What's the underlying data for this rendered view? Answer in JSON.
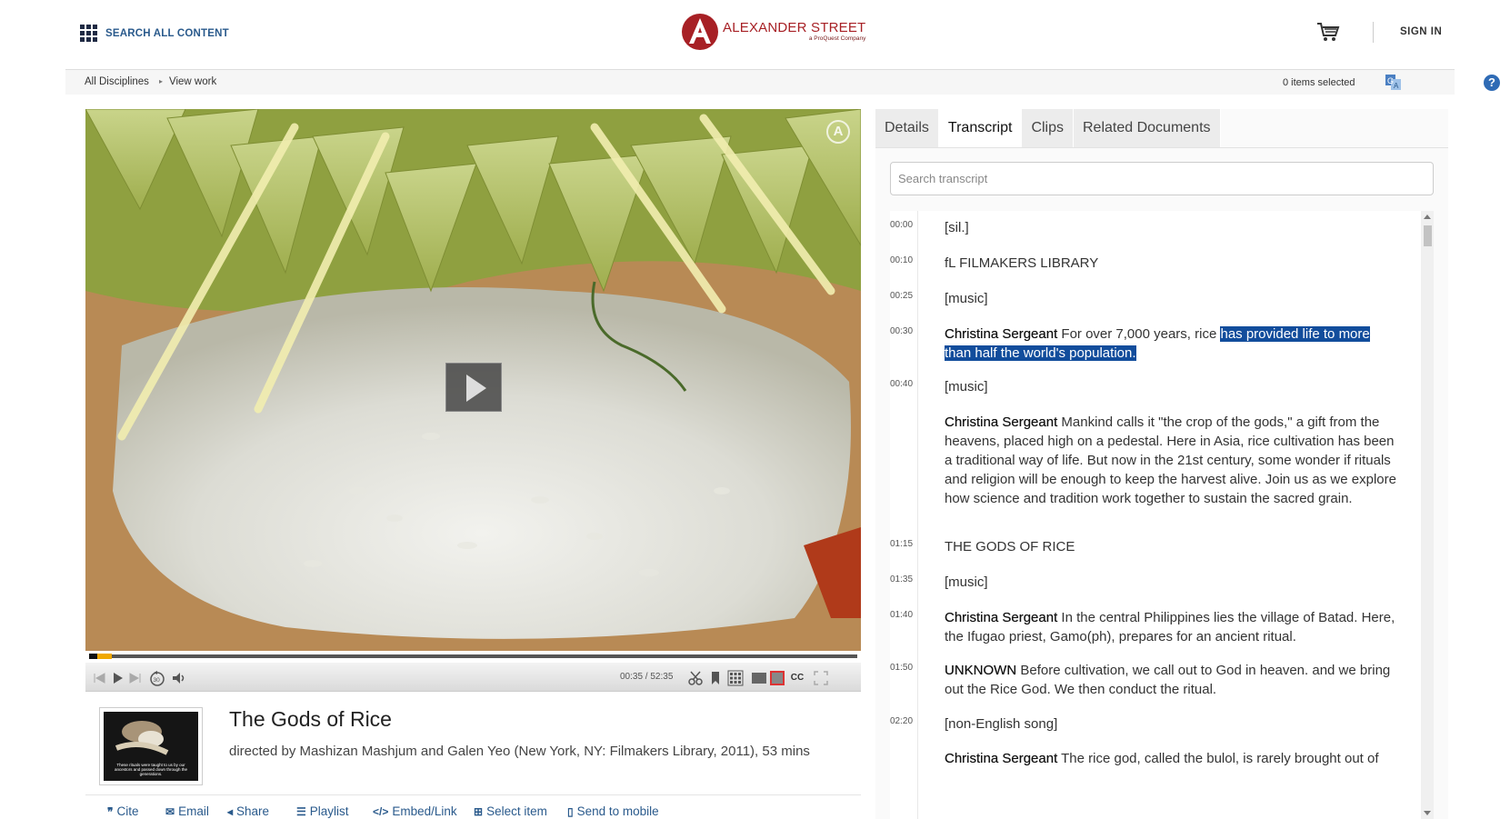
{
  "header": {
    "search_all_label": "SEARCH ALL CONTENT",
    "logo_name": "ALEXANDER STREET",
    "logo_sub": "a ProQuest Company",
    "sign_in_label": "SIGN IN"
  },
  "breadcrumb": {
    "items": [
      "All Disciplines",
      "View work"
    ],
    "separator": "▸",
    "selected_count": "0 items selected",
    "help_label": "?"
  },
  "player": {
    "time_current": "00:35",
    "time_total": "52:35",
    "time_separator": " / ",
    "progress_fraction": 0.011,
    "watermark_letter": "A",
    "cc_label": "CC"
  },
  "work": {
    "title": "The Gods of Rice",
    "credits": "directed by Mashizan Mashjum and Galen Yeo (New York, NY: Filmakers Library, 2011), 53 mins",
    "thumb_caption": "These rituals were taught to us by our ancestors and passed down through the generations."
  },
  "tabs": [
    {
      "label": "Details",
      "active": false
    },
    {
      "label": "Transcript",
      "active": true
    },
    {
      "label": "Clips",
      "active": false
    },
    {
      "label": "Related Documents",
      "active": false
    }
  ],
  "transcript_search": {
    "placeholder": "Search transcript",
    "value": ""
  },
  "transcript": [
    {
      "time": "00:00",
      "speaker": "",
      "text": "[sil.]",
      "highlight": ""
    },
    {
      "time": "00:10",
      "speaker": "",
      "text": "fL FILMAKERS LIBRARY",
      "highlight": ""
    },
    {
      "time": "00:25",
      "speaker": "",
      "text": "[music]",
      "highlight": ""
    },
    {
      "time": "00:30",
      "speaker": "Christina Sergeant",
      "text": "For over 7,000 years, rice ",
      "highlight": "has provided life to more than half the world's population."
    },
    {
      "time": "00:40",
      "speaker": "",
      "text": "[music]",
      "highlight": ""
    },
    {
      "time": "",
      "speaker": "Christina Sergeant",
      "text": "Mankind calls it \"the crop of the gods,\" a gift from the heavens, placed high on a pedestal. Here in Asia, rice cultivation has been a traditional way of life. But now in the 21st century, some wonder if rituals and religion will be enough to keep the harvest alive. Join us as we explore how science and tradition work together to sustain the sacred grain.",
      "highlight": ""
    },
    {
      "time": "01:15",
      "speaker": "",
      "text": "THE GODS OF RICE",
      "highlight": ""
    },
    {
      "time": "01:35",
      "speaker": "",
      "text": "[music]",
      "highlight": ""
    },
    {
      "time": "01:40",
      "speaker": "Christina Sergeant",
      "text": "In the central Philippines lies the village of Batad. Here, the Ifugao priest, Gamo(ph), prepares for an ancient ritual.",
      "highlight": ""
    },
    {
      "time": "01:50",
      "speaker": "UNKNOWN",
      "text": "Before cultivation, we call out to God in heaven. and we bring out the Rice God. We then conduct the ritual.",
      "highlight": ""
    },
    {
      "time": "02:20",
      "speaker": "",
      "text": "[non-English song]",
      "highlight": ""
    },
    {
      "time": "",
      "speaker": "Christina Sergeant",
      "text": "The rice god, called the bulol, is rarely brought out of",
      "highlight": ""
    }
  ],
  "actions": [
    {
      "icon": "quote-icon",
      "glyph": "❞",
      "label": "Cite"
    },
    {
      "icon": "email-icon",
      "glyph": "✉",
      "label": "Email"
    },
    {
      "icon": "share-icon",
      "glyph": "◂",
      "label": "Share"
    },
    {
      "icon": "playlist-icon",
      "glyph": "☰",
      "label": "Playlist"
    },
    {
      "icon": "code-icon",
      "glyph": "</>",
      "label": "Embed/Link"
    },
    {
      "icon": "plus-square-icon",
      "glyph": "⊞",
      "label": "Select item"
    },
    {
      "icon": "mobile-icon",
      "glyph": "▯",
      "label": "Send to mobile"
    }
  ],
  "colors": {
    "brand_red": "#a72025",
    "link_blue": "#2a5a8c",
    "highlight_blue": "#124d9c",
    "progress_orange": "#f0a800"
  }
}
